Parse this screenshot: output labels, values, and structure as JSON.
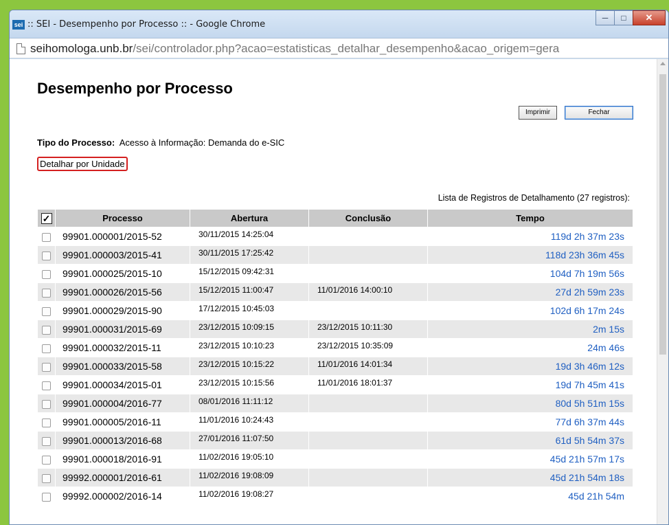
{
  "window": {
    "title": ":: SEI - Desempenho por Processo :: - Google Chrome",
    "logo": "sei",
    "url_host": "seihomologa.unb.br",
    "url_path": "/sei/controlador.php?acao=estatisticas_detalhar_desempenho&acao_origem=gera"
  },
  "page": {
    "title": "Desempenho por Processo",
    "print_button": "Imprimir",
    "close_button": "Fechar",
    "tipo_label": "Tipo do Processo:",
    "tipo_value": "Acesso à Informação: Demanda do e-SIC",
    "detail_link": "Detalhar por Unidade",
    "list_caption": "Lista de Registros de Detalhamento (27 registros):"
  },
  "table": {
    "headers": [
      "Processo",
      "Abertura",
      "Conclusão",
      "Tempo"
    ],
    "rows": [
      {
        "processo": "99901.000001/2015-52",
        "abertura": "30/11/2015 14:25:04",
        "conclusao": "",
        "tempo": "119d 2h 37m 23s"
      },
      {
        "processo": "99901.000003/2015-41",
        "abertura": "30/11/2015 17:25:42",
        "conclusao": "",
        "tempo": "118d 23h 36m 45s"
      },
      {
        "processo": "99901.000025/2015-10",
        "abertura": "15/12/2015 09:42:31",
        "conclusao": "",
        "tempo": "104d 7h 19m 56s"
      },
      {
        "processo": "99901.000026/2015-56",
        "abertura": "15/12/2015 11:00:47",
        "conclusao": "11/01/2016 14:00:10",
        "tempo": "27d 2h 59m 23s"
      },
      {
        "processo": "99901.000029/2015-90",
        "abertura": "17/12/2015 10:45:03",
        "conclusao": "",
        "tempo": "102d 6h 17m 24s"
      },
      {
        "processo": "99901.000031/2015-69",
        "abertura": "23/12/2015 10:09:15",
        "conclusao": "23/12/2015 10:11:30",
        "tempo": "2m 15s"
      },
      {
        "processo": "99901.000032/2015-11",
        "abertura": "23/12/2015 10:10:23",
        "conclusao": "23/12/2015 10:35:09",
        "tempo": "24m 46s"
      },
      {
        "processo": "99901.000033/2015-58",
        "abertura": "23/12/2015 10:15:22",
        "conclusao": "11/01/2016 14:01:34",
        "tempo": "19d 3h 46m 12s"
      },
      {
        "processo": "99901.000034/2015-01",
        "abertura": "23/12/2015 10:15:56",
        "conclusao": "11/01/2016 18:01:37",
        "tempo": "19d 7h 45m 41s"
      },
      {
        "processo": "99901.000004/2016-77",
        "abertura": "08/01/2016 11:11:12",
        "conclusao": "",
        "tempo": "80d 5h 51m 15s"
      },
      {
        "processo": "99901.000005/2016-11",
        "abertura": "11/01/2016 10:24:43",
        "conclusao": "",
        "tempo": "77d 6h 37m 44s"
      },
      {
        "processo": "99901.000013/2016-68",
        "abertura": "27/01/2016 11:07:50",
        "conclusao": "",
        "tempo": "61d 5h 54m 37s"
      },
      {
        "processo": "99901.000018/2016-91",
        "abertura": "11/02/2016 19:05:10",
        "conclusao": "",
        "tempo": "45d 21h 57m 17s"
      },
      {
        "processo": "99992.000001/2016-61",
        "abertura": "11/02/2016 19:08:09",
        "conclusao": "",
        "tempo": "45d 21h 54m 18s"
      },
      {
        "processo": "99992.000002/2016-14",
        "abertura": "11/02/2016 19:08:27",
        "conclusao": "",
        "tempo": "45d 21h 54m"
      }
    ]
  }
}
